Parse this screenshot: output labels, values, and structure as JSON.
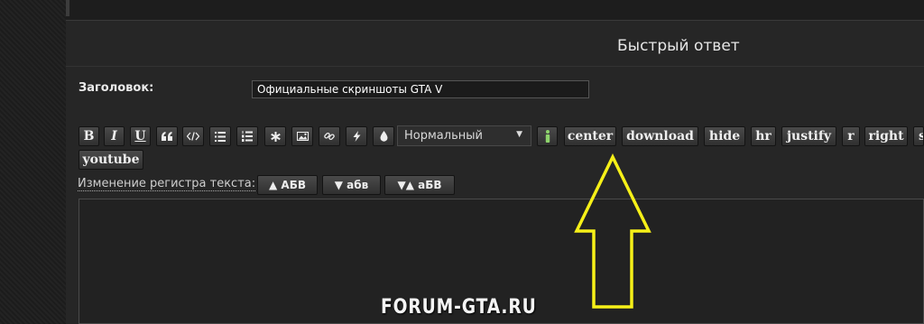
{
  "reply_title": "Быстрый ответ",
  "subject": {
    "label": "Заголовок:",
    "value": "Официальные скриншоты GTA V"
  },
  "toolbar": {
    "font_size_selected": "Нормальный",
    "bbcode_buttons": [
      "center",
      "download",
      "hide",
      "hr",
      "justify",
      "r",
      "right",
      "s",
      "youtube"
    ]
  },
  "case_change": {
    "label": "Изменение регистра текста:",
    "upper": "▲ АБВ",
    "lower": "▼ абв",
    "invert": "▼▲ аБВ"
  },
  "watermark": "FORUM-GTA.RU",
  "colors": {
    "arrow": "#f6f018",
    "info_icon": "#8ed36c",
    "panel": "#262626"
  }
}
